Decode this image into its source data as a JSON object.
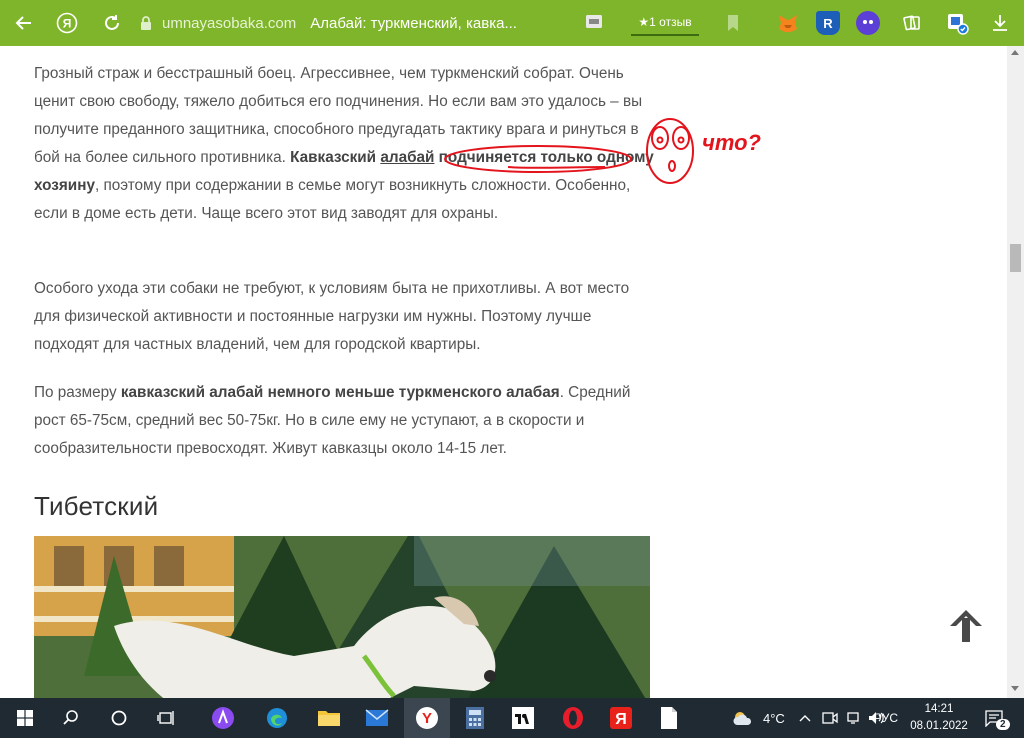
{
  "browser": {
    "domain": "umnayasobaka.com",
    "page_title": "Алабай: туркменский, кавка...",
    "reviews_label": "★1 отзыв"
  },
  "article": {
    "p1_a": "Грозный страж и бесстрашный боец. Агрессивнее, чем туркменский собрат. Очень ценит свою свободу, тяжело добиться его подчинения. Но если вам это удалось – вы получите преданного защитника, способного предугадать тактику врага и ринуться в бой на более сильного противника. ",
    "p1_bold1": "Кавказский ",
    "p1_bold_link": "алабай",
    "p1_bold2": " подчиняется только одному хозяину",
    "p1_b": ", поэтому при содержании в семье могут возникнуть сложности. Особенно, если в доме есть дети. Чаще всего этот вид заводят для охраны.",
    "p2": "Особого ухода эти собаки не требуют, к условиям быта не прихотливы. А вот место для физической активности и постоянные нагрузки им нужны. Поэтому лучше подходят для частных владений, чем для городской квартиры.",
    "p3_a": "По размеру ",
    "p3_bold": "кавказский алабай немного меньше туркменского алабая",
    "p3_b": ". Средний рост 65-75см, средний вес 50-75кг. Но в силе ему не уступают, а в скорости и сообразительности превосходят. Живут кавказцы около 14-15 лет.",
    "heading": "Тибетский"
  },
  "annotation": {
    "text": "что?"
  },
  "taskbar": {
    "weather": "4°C",
    "language": "РУС",
    "time": "14:21",
    "date": "08.01.2022",
    "notifications": "2"
  },
  "colors": {
    "toolbar": "#7fb52a",
    "annotation": "#e3141c",
    "taskbar": "#1f2a33"
  }
}
